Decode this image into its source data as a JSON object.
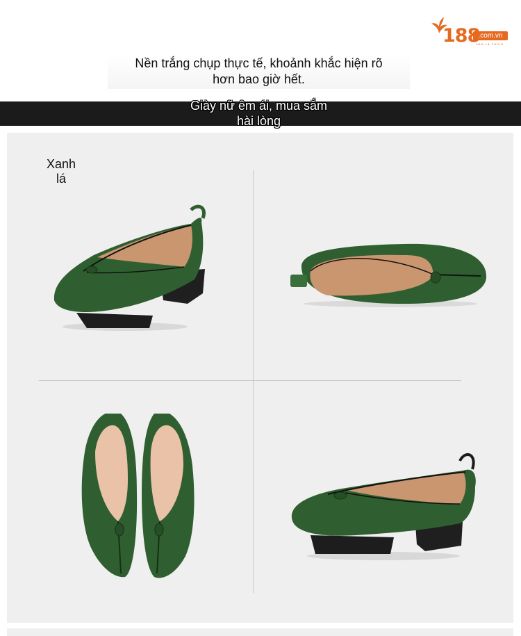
{
  "logo": {
    "number": "188",
    "domain": ".com.vn",
    "tagline": "XEM LÀ THÍCH",
    "brand_color": "#e56a1f"
  },
  "caption": {
    "line1": "Nền trắng chụp thực tế, khoảnh khắc hiện rõ",
    "line2": "hơn bao giờ hết."
  },
  "banner": {
    "line1": "Giày nữ êm ái, mua sắm",
    "line2": "hài lòng"
  },
  "product": {
    "color_line1": "Xanh",
    "color_line2": "lá",
    "shoe_color": "#2e5a2e",
    "lining_color": "#d4a07a",
    "sole_color": "#1d1d1d",
    "views": [
      "side-view",
      "top-view-single",
      "top-view-pair",
      "side-view-right"
    ]
  }
}
